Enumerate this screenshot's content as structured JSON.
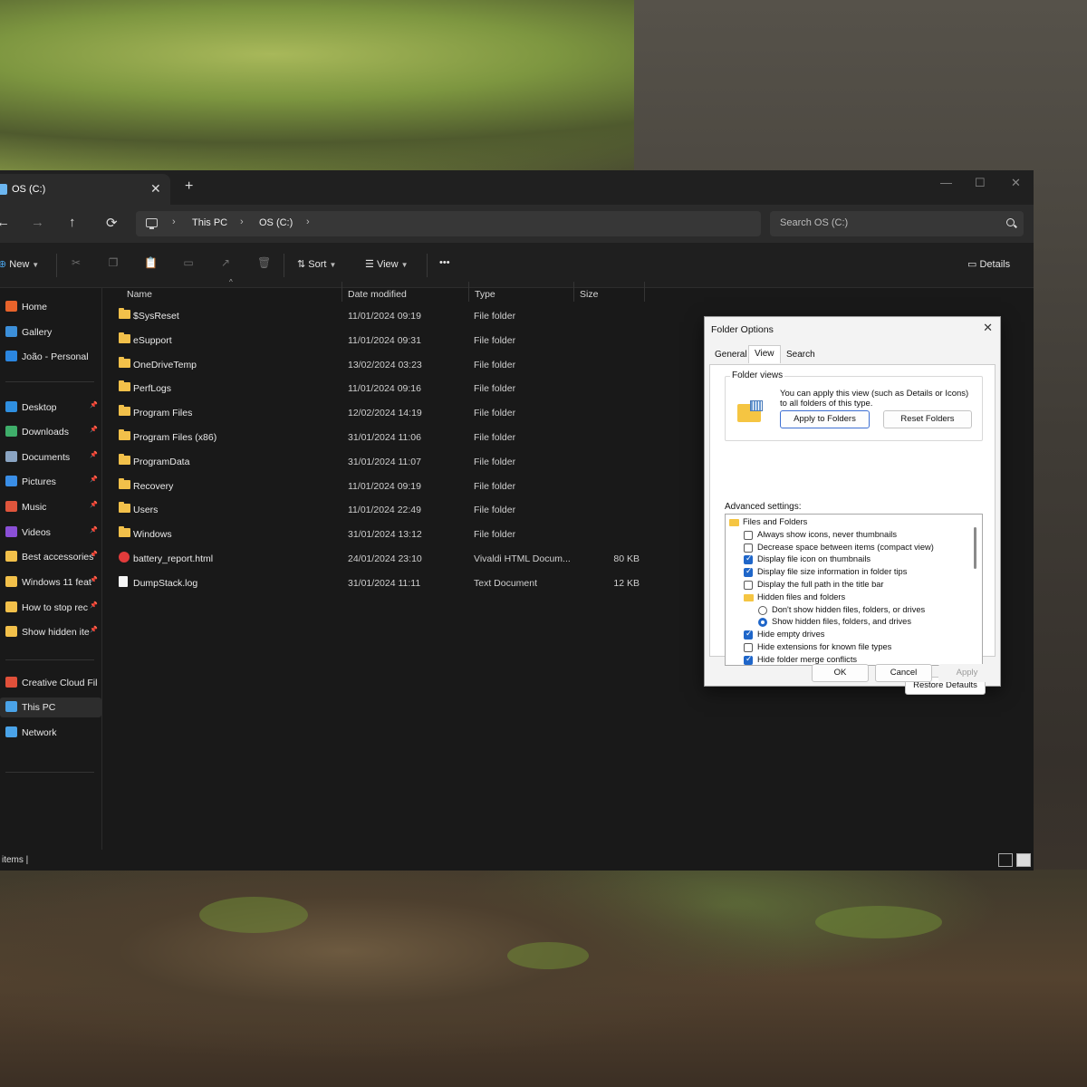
{
  "window": {
    "tab_title": "OS (C:)",
    "tab_close": "✕",
    "tab_add": "+",
    "minimize": "—",
    "maximize": "☐",
    "close": "✕"
  },
  "nav": {
    "back": "←",
    "forward": "→",
    "up": "↑",
    "refresh": "⟳",
    "breadcrumb": [
      "This PC",
      "OS (C:)"
    ],
    "search_placeholder": "Search OS (C:)"
  },
  "toolbar": {
    "new_label": "New",
    "sort_label": "Sort",
    "view_label": "View",
    "more_label": "•••",
    "details_label": "Details",
    "icons": [
      "cut-icon",
      "copy-icon",
      "paste-icon",
      "rename-icon",
      "share-icon",
      "delete-icon"
    ]
  },
  "sidebar": {
    "items": [
      {
        "label": "Home",
        "icon": "home-icon",
        "color": "#e8632b",
        "pinned": false
      },
      {
        "label": "Gallery",
        "icon": "gallery-icon",
        "color": "#3c8fd9",
        "pinned": false
      },
      {
        "label": "João - Personal",
        "icon": "onedrive-icon",
        "color": "#2b86e0",
        "pinned": false
      },
      {
        "label": "Desktop",
        "icon": "desktop-icon",
        "color": "#2f8fe0",
        "pinned": true
      },
      {
        "label": "Downloads",
        "icon": "downloads-icon",
        "color": "#3fae6a",
        "pinned": true
      },
      {
        "label": "Documents",
        "icon": "documents-icon",
        "color": "#8aa4c2",
        "pinned": true
      },
      {
        "label": "Pictures",
        "icon": "pictures-icon",
        "color": "#3a8ee6",
        "pinned": true
      },
      {
        "label": "Music",
        "icon": "music-icon",
        "color": "#e0553c",
        "pinned": true
      },
      {
        "label": "Videos",
        "icon": "videos-icon",
        "color": "#8a4fd6",
        "pinned": true
      },
      {
        "label": "Best accessories",
        "icon": "folder-icon",
        "color": "#f2c04a",
        "pinned": true
      },
      {
        "label": "Windows 11 feat",
        "icon": "folder-icon",
        "color": "#f2c04a",
        "pinned": true
      },
      {
        "label": "How to stop rec",
        "icon": "folder-icon",
        "color": "#f2c04a",
        "pinned": true
      },
      {
        "label": "Show hidden ite",
        "icon": "folder-icon",
        "color": "#f2c04a",
        "pinned": true
      },
      {
        "label": "Creative Cloud File",
        "icon": "creative-cloud-icon",
        "color": "#e0503a",
        "pinned": false
      },
      {
        "label": "This PC",
        "icon": "this-pc-icon",
        "color": "#4aa3e8",
        "pinned": false
      },
      {
        "label": "Network",
        "icon": "network-icon",
        "color": "#4aa3e8",
        "pinned": false
      }
    ],
    "pin_glyph": "📌"
  },
  "columns": {
    "name": "Name",
    "date": "Date modified",
    "type": "Type",
    "size": "Size"
  },
  "files": [
    {
      "name": "$SysReset",
      "date": "11/01/2024 09:19",
      "type": "File folder",
      "size": "",
      "kind": "folder"
    },
    {
      "name": "eSupport",
      "date": "11/01/2024 09:31",
      "type": "File folder",
      "size": "",
      "kind": "folder"
    },
    {
      "name": "OneDriveTemp",
      "date": "13/02/2024 03:23",
      "type": "File folder",
      "size": "",
      "kind": "folder"
    },
    {
      "name": "PerfLogs",
      "date": "11/01/2024 09:16",
      "type": "File folder",
      "size": "",
      "kind": "folder"
    },
    {
      "name": "Program Files",
      "date": "12/02/2024 14:19",
      "type": "File folder",
      "size": "",
      "kind": "folder"
    },
    {
      "name": "Program Files (x86)",
      "date": "31/01/2024 11:06",
      "type": "File folder",
      "size": "",
      "kind": "folder"
    },
    {
      "name": "ProgramData",
      "date": "31/01/2024 11:07",
      "type": "File folder",
      "size": "",
      "kind": "folder"
    },
    {
      "name": "Recovery",
      "date": "11/01/2024 09:19",
      "type": "File folder",
      "size": "",
      "kind": "folder"
    },
    {
      "name": "Users",
      "date": "11/01/2024 22:49",
      "type": "File folder",
      "size": "",
      "kind": "folder"
    },
    {
      "name": "Windows",
      "date": "31/01/2024 13:12",
      "type": "File folder",
      "size": "",
      "kind": "folder"
    },
    {
      "name": "battery_report.html",
      "date": "24/01/2024 23:10",
      "type": "Vivaldi HTML Docum...",
      "size": "80 KB",
      "kind": "html"
    },
    {
      "name": "DumpStack.log",
      "date": "31/01/2024 11:11",
      "type": "Text Document",
      "size": "12 KB",
      "kind": "txt"
    }
  ],
  "status": {
    "text": "items  |"
  },
  "dialog": {
    "title": "Folder Options",
    "close": "✕",
    "tabs": [
      "General",
      "View",
      "Search"
    ],
    "active_tab": "View",
    "folder_views_label": "Folder views",
    "folder_views_desc": "You can apply this view (such as Details or Icons) to all folders of this type.",
    "apply_to_folders": "Apply to Folders",
    "reset_folders": "Reset Folders",
    "advanced_label": "Advanced settings:",
    "settings": [
      {
        "label": "Files and Folders",
        "control": "folder",
        "checked": false,
        "indent": 0
      },
      {
        "label": "Always show icons, never thumbnails",
        "control": "checkbox",
        "checked": false,
        "indent": 1
      },
      {
        "label": "Decrease space between items (compact view)",
        "control": "checkbox",
        "checked": false,
        "indent": 1
      },
      {
        "label": "Display file icon on thumbnails",
        "control": "checkbox",
        "checked": true,
        "indent": 1
      },
      {
        "label": "Display file size information in folder tips",
        "control": "checkbox",
        "checked": true,
        "indent": 1
      },
      {
        "label": "Display the full path in the title bar",
        "control": "checkbox",
        "checked": false,
        "indent": 1
      },
      {
        "label": "Hidden files and folders",
        "control": "folder",
        "checked": false,
        "indent": 1
      },
      {
        "label": "Don't show hidden files, folders, or drives",
        "control": "radio",
        "checked": false,
        "indent": 2
      },
      {
        "label": "Show hidden files, folders, and drives",
        "control": "radio",
        "checked": true,
        "indent": 2
      },
      {
        "label": "Hide empty drives",
        "control": "checkbox",
        "checked": true,
        "indent": 1
      },
      {
        "label": "Hide extensions for known file types",
        "control": "checkbox",
        "checked": false,
        "indent": 1
      },
      {
        "label": "Hide folder merge conflicts",
        "control": "checkbox",
        "checked": true,
        "indent": 1
      }
    ],
    "restore_defaults": "Restore Defaults",
    "ok": "OK",
    "cancel": "Cancel",
    "apply": "Apply"
  }
}
